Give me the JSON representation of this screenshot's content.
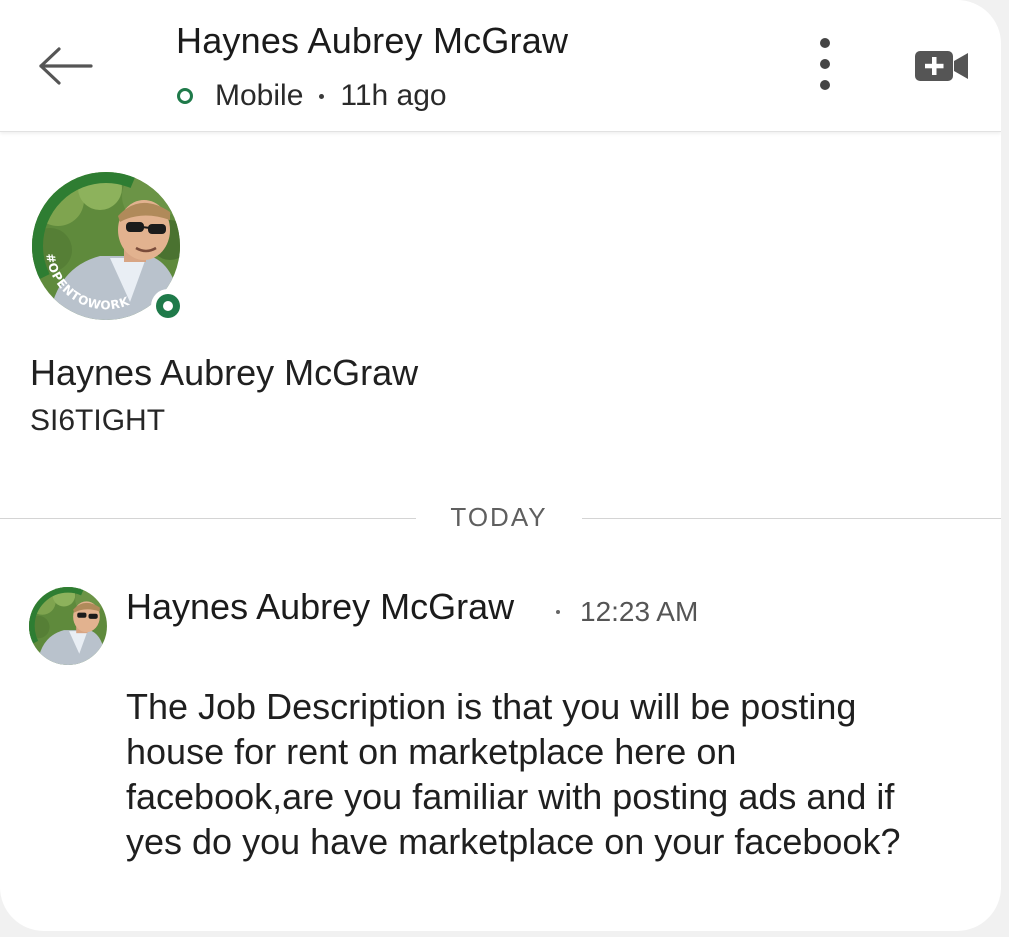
{
  "header": {
    "title": "Haynes Aubrey McGraw",
    "presence_label": "Mobile",
    "last_active": "11h ago",
    "icons": {
      "back": "arrow-left-icon",
      "more": "more-vertical-icon",
      "video": "video-call-add-icon"
    }
  },
  "profile": {
    "name": "Haynes Aubrey McGraw",
    "headline": "SI6TIGHT",
    "badge_text": "#OPENTOWORK",
    "online_status": "online"
  },
  "divider": {
    "label": "TODAY"
  },
  "message": {
    "sender": "Haynes Aubrey McGraw",
    "time": "12:23 AM",
    "body": "The Job Description is that you will be posting house for rent on marketplace here on facebook,are you familiar with posting ads and if yes do you have marketplace on your facebook?"
  },
  "colors": {
    "open_to_work_green": "#2e7d32",
    "online_green": "#1f7a4a",
    "icon_gray": "#555555"
  }
}
